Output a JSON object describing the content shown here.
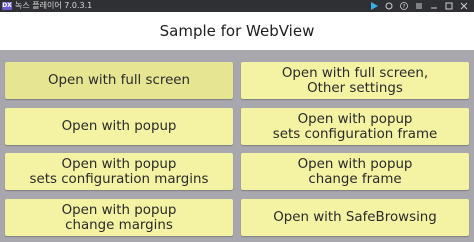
{
  "titlebar": {
    "app_logo_text": "DX",
    "app_title": "녹스 플레이어 7.0.3.1",
    "icons": [
      "play-icon",
      "circle-icon",
      "question-icon",
      "menu-icon",
      "minimize-icon",
      "restore-icon",
      "close-icon"
    ]
  },
  "header": {
    "title": "Sample for WebView"
  },
  "buttons": {
    "full_screen": "Open with full screen",
    "full_screen_other": "Open with full screen,\nOther settings",
    "popup": "Open with popup",
    "popup_config_frame": "Open with popup\nsets configuration frame",
    "popup_config_margins": "Open with popup\nsets configuration margins",
    "popup_change_frame": "Open with popup\nchange frame",
    "popup_change_margins": "Open with popup\nchange margins",
    "safebrowsing": "Open with SafeBrowsing"
  },
  "colors": {
    "button_bg": "#f3f3a3",
    "button_pressed_bg": "#e6e692",
    "content_bg": "#a7a7ad",
    "titlebar_bg": "#2f3034",
    "play_icon": "#3ab0e8"
  }
}
